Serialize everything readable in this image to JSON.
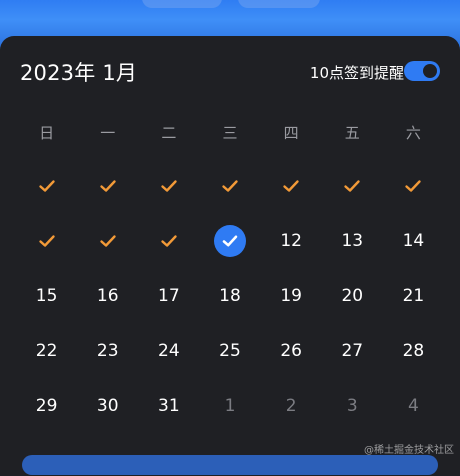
{
  "header": {
    "title": "2023年 1月",
    "remind_label": "10点签到提醒",
    "remind_enabled": true
  },
  "weekdays": [
    "日",
    "一",
    "二",
    "三",
    "四",
    "五",
    "六"
  ],
  "days": [
    {
      "label": "",
      "state": "checked"
    },
    {
      "label": "",
      "state": "checked"
    },
    {
      "label": "",
      "state": "checked"
    },
    {
      "label": "",
      "state": "checked"
    },
    {
      "label": "",
      "state": "checked"
    },
    {
      "label": "",
      "state": "checked"
    },
    {
      "label": "",
      "state": "checked"
    },
    {
      "label": "",
      "state": "checked"
    },
    {
      "label": "",
      "state": "checked"
    },
    {
      "label": "",
      "state": "checked"
    },
    {
      "label": "",
      "state": "today-checked"
    },
    {
      "label": "12",
      "state": "normal"
    },
    {
      "label": "13",
      "state": "normal"
    },
    {
      "label": "14",
      "state": "normal"
    },
    {
      "label": "15",
      "state": "normal"
    },
    {
      "label": "16",
      "state": "normal"
    },
    {
      "label": "17",
      "state": "normal"
    },
    {
      "label": "18",
      "state": "normal"
    },
    {
      "label": "19",
      "state": "normal"
    },
    {
      "label": "20",
      "state": "normal"
    },
    {
      "label": "21",
      "state": "normal"
    },
    {
      "label": "22",
      "state": "normal"
    },
    {
      "label": "23",
      "state": "normal"
    },
    {
      "label": "24",
      "state": "normal"
    },
    {
      "label": "25",
      "state": "normal"
    },
    {
      "label": "26",
      "state": "normal"
    },
    {
      "label": "27",
      "state": "normal"
    },
    {
      "label": "28",
      "state": "normal"
    },
    {
      "label": "29",
      "state": "normal"
    },
    {
      "label": "30",
      "state": "normal"
    },
    {
      "label": "31",
      "state": "normal"
    },
    {
      "label": "1",
      "state": "next-month"
    },
    {
      "label": "2",
      "state": "next-month"
    },
    {
      "label": "3",
      "state": "next-month"
    },
    {
      "label": "4",
      "state": "next-month"
    }
  ],
  "colors": {
    "check": "#f29a38",
    "accent": "#2f7bf3"
  },
  "icons": {
    "checked": "checkmark-icon",
    "today": "today-check-icon"
  },
  "watermark": "@稀土掘金技术社区"
}
